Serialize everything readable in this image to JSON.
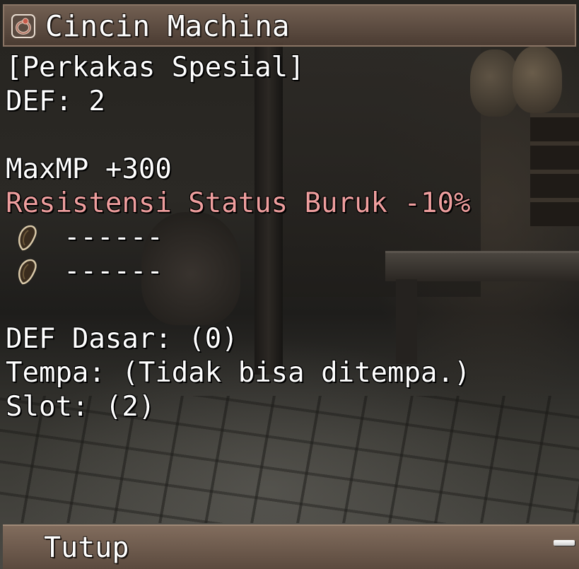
{
  "window": {
    "title": "Cincin Machina",
    "title_icon": "ring-icon"
  },
  "item": {
    "category": "[Perkakas Spesial]",
    "def": "DEF: 2",
    "stats": [
      "MaxMP +300"
    ],
    "special_effect": "Resistensi Status Buruk -10%",
    "special_effect_color": "#ee9e9e",
    "slots": [
      {
        "icon": "empty-slot-seed-icon",
        "value": "------"
      },
      {
        "icon": "empty-slot-seed-icon",
        "value": "------"
      }
    ],
    "base_def": "DEF Dasar: (0)",
    "forge": "Tempa: (Tidak bisa ditempa.)",
    "slot_count": "Slot: (2)"
  },
  "footer": {
    "close_label": "Tutup",
    "collapse_icon": "minus-icon"
  }
}
